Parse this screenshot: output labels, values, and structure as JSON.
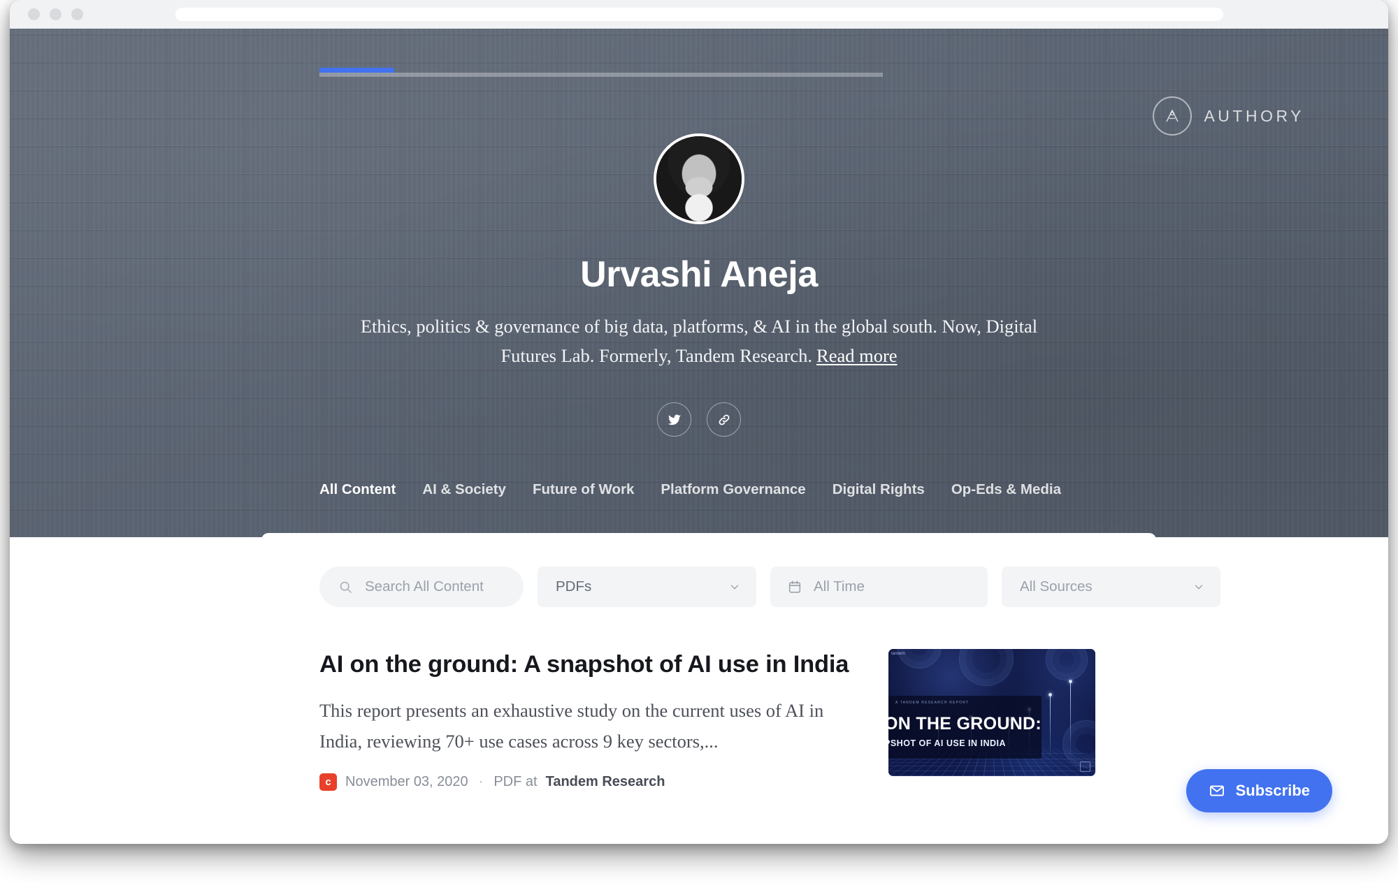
{
  "browser": {
    "url_value": "",
    "url_placeholder": ""
  },
  "hero": {
    "brand_name": "AUTHORY",
    "profile_name": "Urvashi Aneja",
    "bio": "Ethics, politics & governance of big data, platforms, & AI in the global south. Now, Digital Futures Lab. Formerly, Tandem Research.",
    "read_more": "Read more",
    "socials": [
      {
        "name": "twitter",
        "icon": "twitter-icon"
      },
      {
        "name": "website-link",
        "icon": "link-icon"
      }
    ]
  },
  "tabs": [
    {
      "label": "All Content",
      "active": true
    },
    {
      "label": "AI & Society",
      "active": false
    },
    {
      "label": "Future of Work",
      "active": false
    },
    {
      "label": "Platform Governance",
      "active": false
    },
    {
      "label": "Digital Rights",
      "active": false
    },
    {
      "label": "Op-Eds & Media",
      "active": false
    }
  ],
  "filters": {
    "search_placeholder": "Search All Content",
    "search_value": "",
    "type_filter": "PDFs",
    "date_filter": "All Time",
    "source_filter": "All Sources"
  },
  "articles": [
    {
      "title": "AI on the ground: A snapshot of AI use in India",
      "excerpt": "This report presents an exhaustive study on the current uses of AI in India, reviewing 70+ use cases across 9 key sectors,...",
      "badge_letter": "c",
      "date": "November 03, 2020",
      "separator": "·",
      "format_prefix": "PDF at",
      "source": "Tandem Research",
      "thumbnail": {
        "kicker": "A TANDEM RESEARCH REPORT",
        "title": "ON THE GROUND:",
        "subtitle": "PSHOT OF AI USE IN INDIA",
        "corner_label": "tandem"
      }
    }
  ],
  "subscribe": {
    "label": "Subscribe",
    "icon": "envelope-icon"
  },
  "colors": {
    "accent_blue": "#4272f0",
    "hero_slate": "#5b6472",
    "badge_red": "#e8402a",
    "filter_grey": "#f3f4f6"
  }
}
